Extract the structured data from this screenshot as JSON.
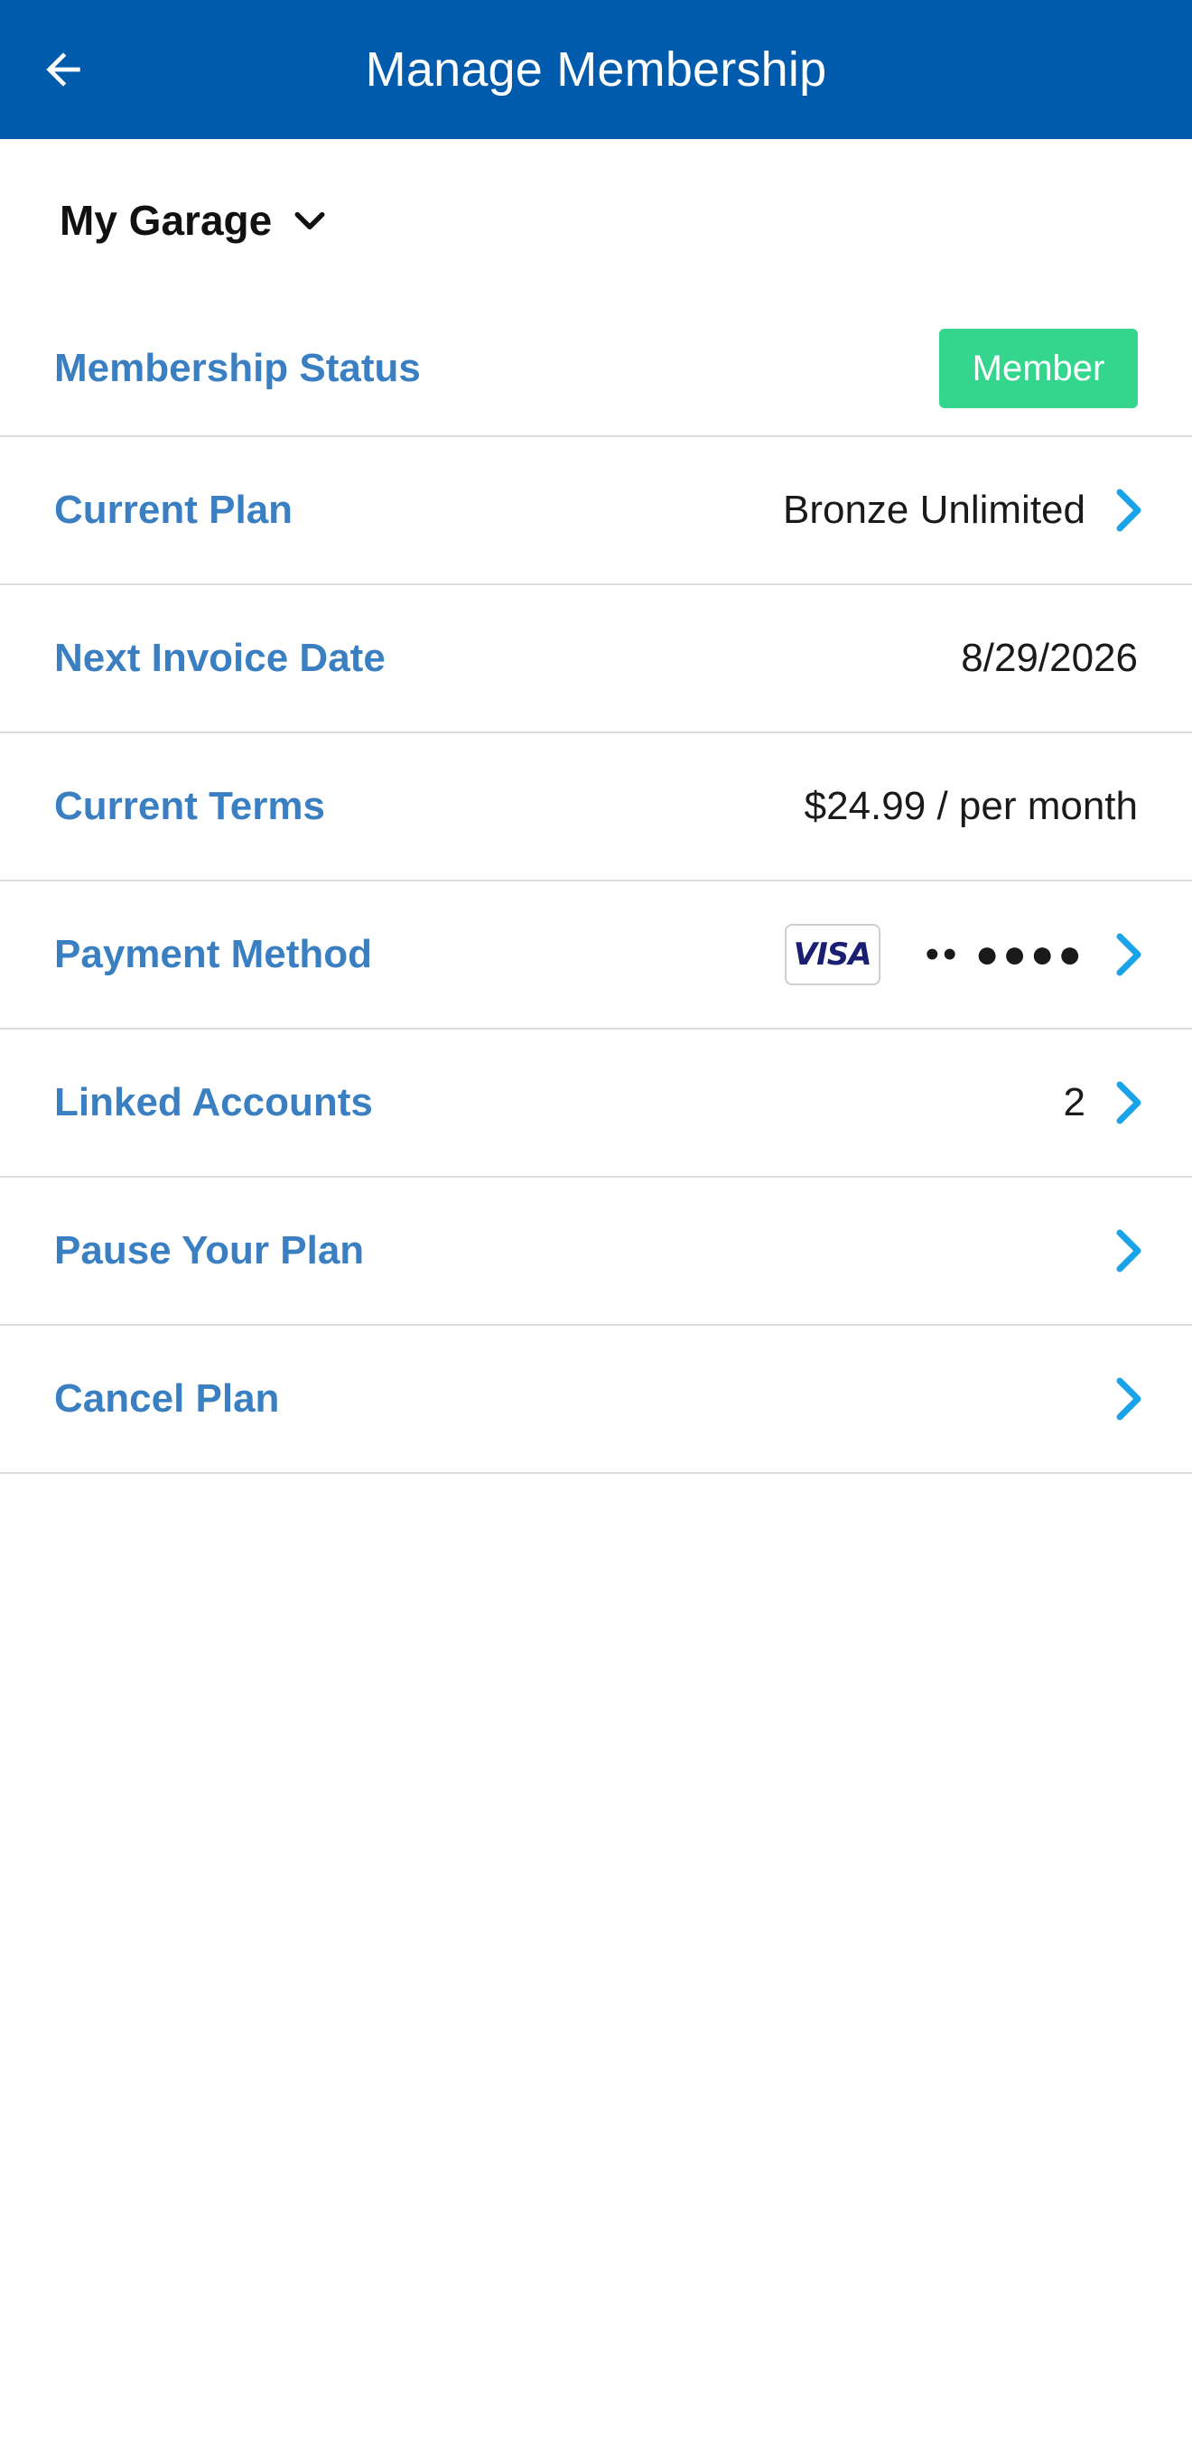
{
  "app_bar": {
    "title": "Manage Membership",
    "back_icon": "arrow-left-icon"
  },
  "garage": {
    "label": "My Garage",
    "dropdown_icon": "chevron-down-icon"
  },
  "rows": {
    "status": {
      "label": "Membership Status",
      "badge": "Member",
      "badge_color": "#33D68C"
    },
    "plan": {
      "label": "Current Plan",
      "value": "Bronze Unlimited"
    },
    "invoice": {
      "label": "Next Invoice Date",
      "value": "8/29/2026"
    },
    "terms": {
      "label": "Current Terms",
      "value": "$24.99 / per month"
    },
    "payment": {
      "label": "Payment Method",
      "card_brand": "VISA",
      "masked": "•• ●●●●"
    },
    "linked": {
      "label": "Linked Accounts",
      "value": "2"
    },
    "pause": {
      "label": "Pause Your Plan"
    },
    "cancel": {
      "label": "Cancel Plan"
    }
  },
  "colors": {
    "app_bar": "#005BAC",
    "label": "#3A7FC1",
    "chevron": "#1AA3E8"
  }
}
